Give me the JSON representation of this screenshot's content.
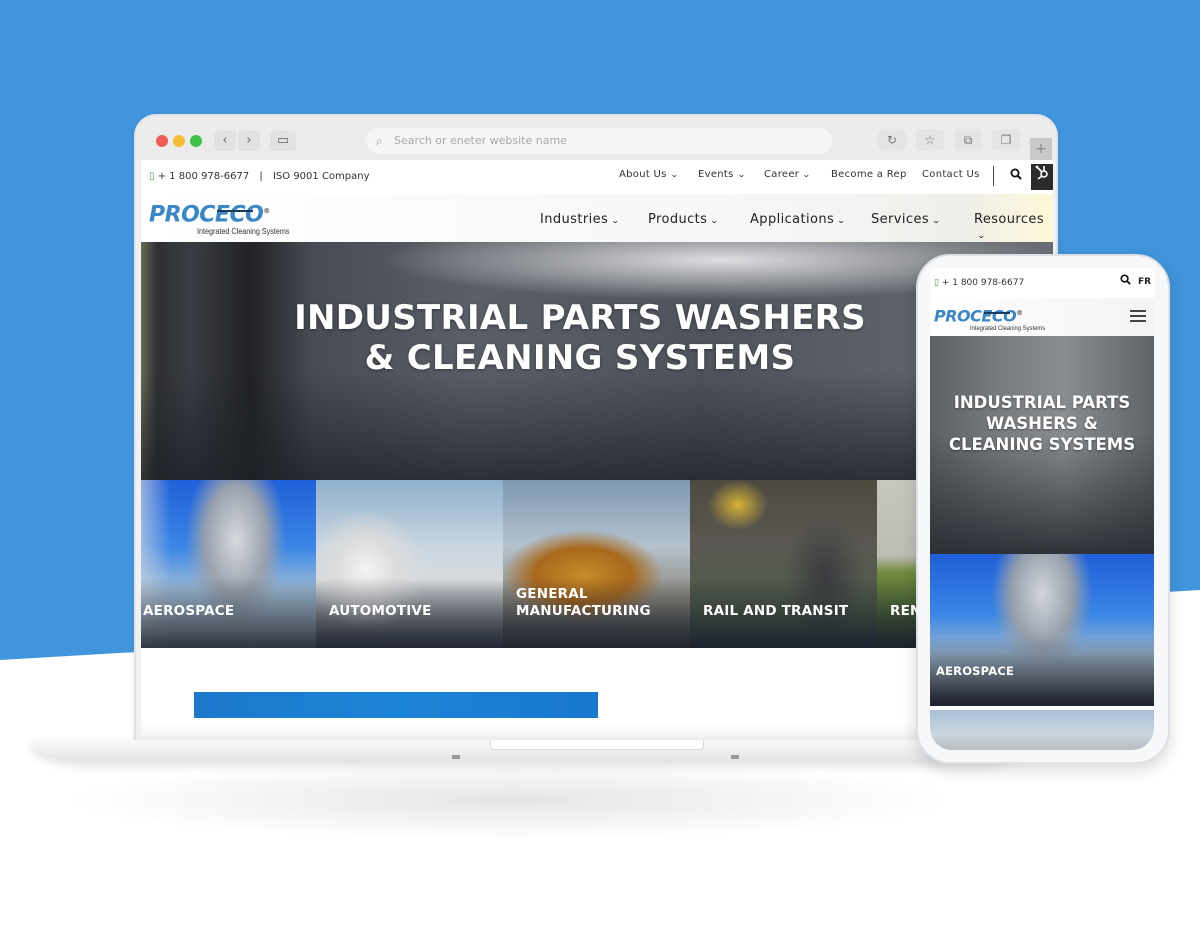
{
  "colors": {
    "background_blue": "#4195dc",
    "brand_blue": "#3a87c8",
    "cta_blue": "#1c84d6",
    "hubspot_dark": "#2b2b2b"
  },
  "browser": {
    "address_placeholder": "Search or eneter website name",
    "back_icon": "‹",
    "forward_icon": "›",
    "sidebar_icon": "▭",
    "reload_icon": "↻",
    "bookmark_icon": "☆",
    "share_icon": "⧉",
    "tabs_icon": "❐",
    "new_tab_icon": "+",
    "search_glyph": "⌕"
  },
  "desktop": {
    "topbar": {
      "phone_icon": "▯",
      "phone": "+ 1 800 978-6677",
      "separator": "|",
      "iso": "ISO 9001 Company",
      "links": [
        {
          "label": "About Us",
          "dropdown": true
        },
        {
          "label": "Events",
          "dropdown": true
        },
        {
          "label": "Career",
          "dropdown": true
        },
        {
          "label": "Become a Rep",
          "dropdown": false
        },
        {
          "label": "Contact Us",
          "dropdown": false
        }
      ],
      "search_icon": "🔍",
      "hubspot_icon": "⚙"
    },
    "logo": {
      "word": "PROCECO",
      "registered": "®",
      "tagline": "Integrated Cleaning Systems"
    },
    "mainnav": [
      {
        "label": "Industries"
      },
      {
        "label": "Products"
      },
      {
        "label": "Applications"
      },
      {
        "label": "Services"
      },
      {
        "label": "Resources"
      }
    ],
    "chevron": "⌄",
    "hero": {
      "line1": "INDUSTRIAL PARTS WASHERS",
      "line2": "& CLEANING SYSTEMS"
    },
    "tiles": [
      {
        "label": "AEROSPACE"
      },
      {
        "label": "AUTOMOTIVE"
      },
      {
        "label": "GENERAL MANUFACTURING"
      },
      {
        "label": "RAIL AND TRANSIT"
      },
      {
        "label": "REN"
      }
    ]
  },
  "mobile": {
    "phone_icon": "▯",
    "phone": "+ 1 800 978-6677",
    "search_icon": "🔍",
    "lang": "FR",
    "logo": {
      "word": "PROCECO",
      "registered": "®",
      "tagline": "Integrated Cleaning Systems"
    },
    "hero": {
      "line1": "INDUSTRIAL PARTS",
      "line2": "WASHERS &",
      "line3": "CLEANING SYSTEMS"
    },
    "tiles": [
      {
        "label": "AEROSPACE"
      }
    ]
  }
}
